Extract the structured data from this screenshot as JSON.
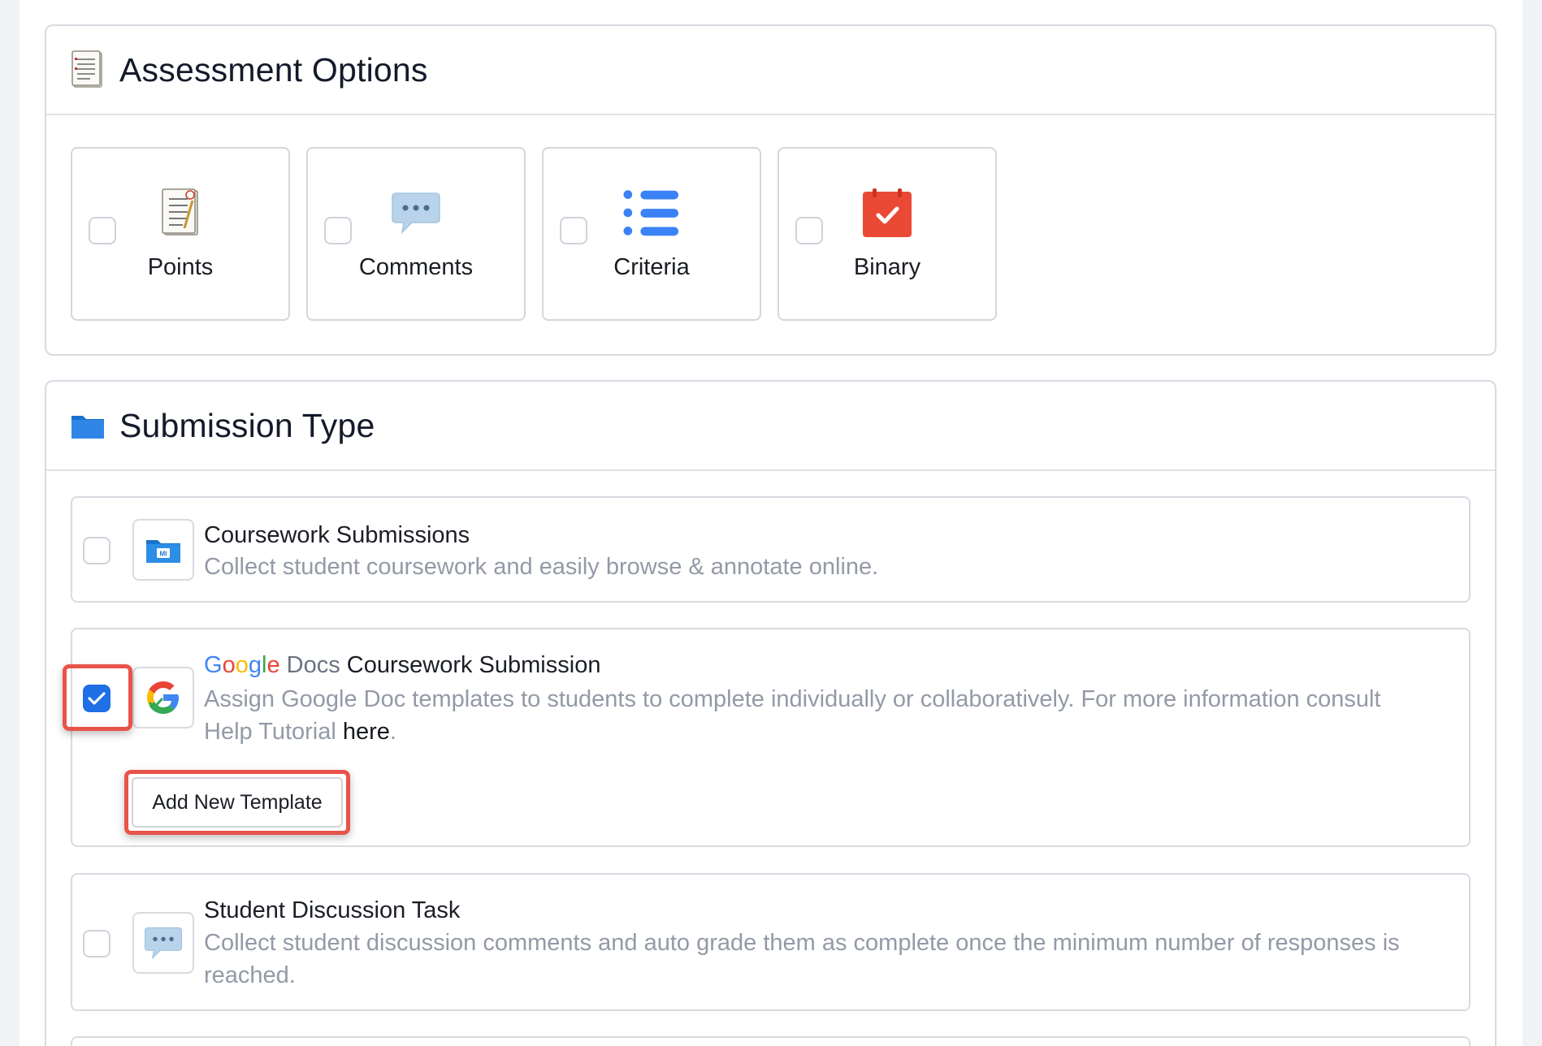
{
  "assessment": {
    "title": "Assessment Options",
    "options": [
      {
        "label": "Points",
        "checked": false,
        "icon": "score-sheet-icon"
      },
      {
        "label": "Comments",
        "checked": false,
        "icon": "speech-bubble-icon"
      },
      {
        "label": "Criteria",
        "checked": false,
        "icon": "list-icon"
      },
      {
        "label": "Binary",
        "checked": false,
        "icon": "calendar-check-icon"
      }
    ]
  },
  "submission": {
    "title": "Submission Type",
    "rows": [
      {
        "title": "Coursework Submissions",
        "description": "Collect student coursework and easily browse & annotate online.",
        "checked": false,
        "icon": "folder-icon"
      },
      {
        "brand_google": "Google",
        "brand_docs": "Docs",
        "title": "Coursework Submission",
        "description": "Assign Google Doc templates to students to complete individually or collaboratively. For more information consult Help Tutorial",
        "link_text": "here",
        "after_link": ".",
        "checked": true,
        "icon": "google-g-icon",
        "button_label": "Add New Template"
      },
      {
        "title": "Student Discussion Task",
        "description": "Collect student discussion comments and auto grade them as complete once the minimum number of responses is reached.",
        "checked": false,
        "icon": "speech-bubble-icon"
      }
    ]
  },
  "colors": {
    "accent": "#1f6fe5",
    "highlight": "#e8534a",
    "muted_text": "#939aa6"
  }
}
